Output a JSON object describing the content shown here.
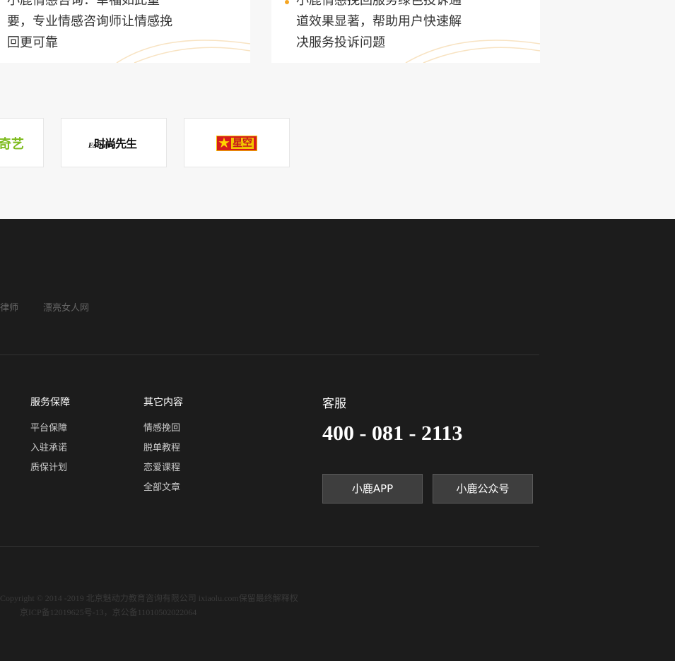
{
  "cards": {
    "left": {
      "lines": [
        "小鹿情感咨询：幸福如此重",
        "要，专业情感咨询师让情感挽",
        "回更可靠"
      ]
    },
    "right": {
      "lines": [
        "小鹿情感挽回服务绿色投诉通",
        "道效果显著，帮助用户快速解",
        "决服务投诉问题"
      ]
    }
  },
  "partners": [
    {
      "name": "iqiyi-logo",
      "text": "奇艺"
    },
    {
      "name": "esquire-logo",
      "text_cn": "时尚先生",
      "text_en": "Esquire"
    },
    {
      "name": "xingkong-logo",
      "text": "星空"
    }
  ],
  "friend_links": [
    "律师",
    "漂亮女人网"
  ],
  "footer": {
    "columns": [
      {
        "title": "服务保障",
        "items": [
          "平台保障",
          "入驻承诺",
          "质保计划"
        ]
      },
      {
        "title": "其它内容",
        "items": [
          "情感挽回",
          "脱单教程",
          "恋爱课程",
          "全部文章"
        ]
      }
    ],
    "service": {
      "title": "客服",
      "phone": "400 - 081 - 2113",
      "buttons": [
        "小鹿APP",
        "小鹿公众号"
      ]
    },
    "copyright": "Copyright © 2014 -2019   北京魅动力教育咨询有限公司  ixiaolu.com保留最终解释权",
    "icp": "京ICP备12019625号-13，京公备11010502022064"
  },
  "colors": {
    "accent": "#f5a623",
    "footer_bg": "#1c1c1c",
    "top_bg": "#f7f7f7"
  }
}
